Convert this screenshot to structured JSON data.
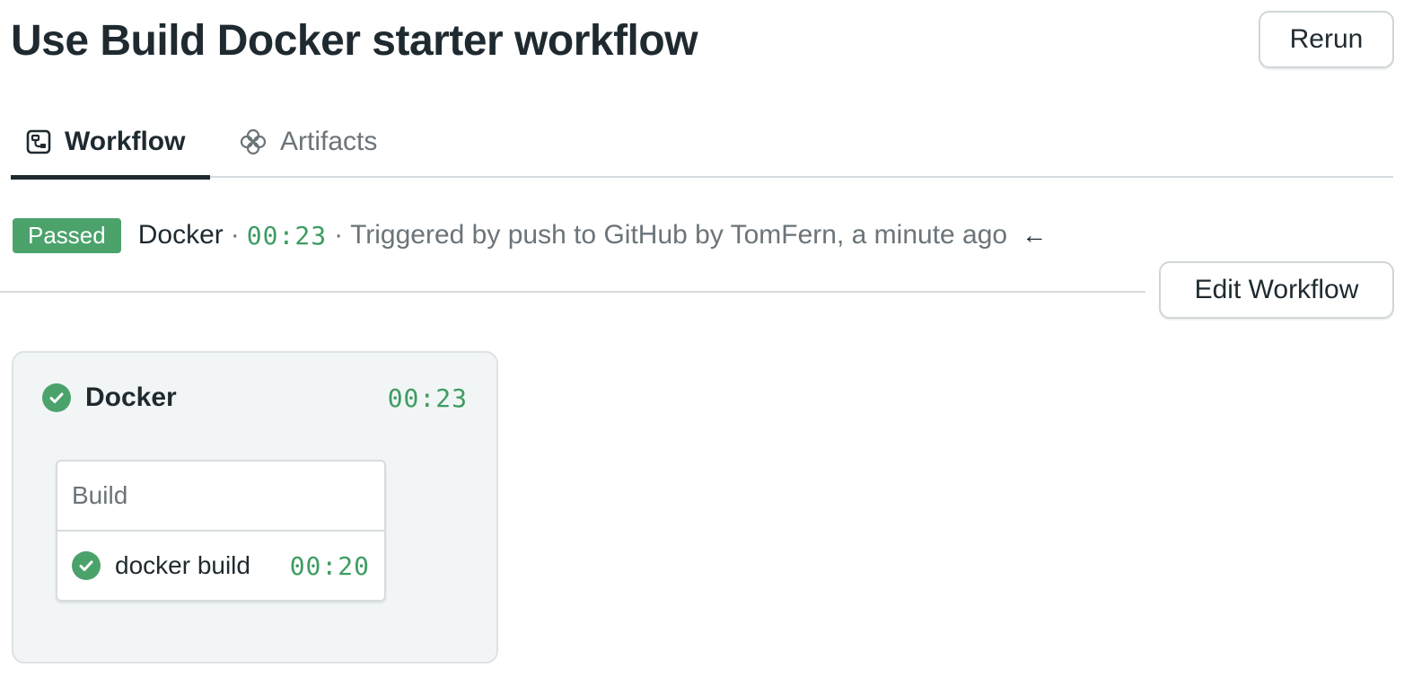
{
  "header": {
    "title": "Use Build Docker starter workflow",
    "rerun_label": "Rerun"
  },
  "tabs": [
    {
      "label": "Workflow",
      "icon": "workflow-icon",
      "active": true
    },
    {
      "label": "Artifacts",
      "icon": "artifacts-icon",
      "active": false
    }
  ],
  "status": {
    "badge": "Passed",
    "pipeline": "Docker",
    "separator": "·",
    "duration": "00:23",
    "trigger_text": "Triggered by push to GitHub by TomFern, a minute ago",
    "arrow": "←"
  },
  "toolbar": {
    "edit_label": "Edit Workflow"
  },
  "block": {
    "name": "Docker",
    "duration": "00:23",
    "status_icon": "check-circle-icon",
    "job_group": {
      "name": "Build",
      "jobs": [
        {
          "name": "docker build",
          "duration": "00:20",
          "status_icon": "check-circle-icon"
        }
      ]
    }
  },
  "colors": {
    "passed": "#4ba26b",
    "duration_text": "#3d9c62",
    "text": "#1f2a30",
    "muted": "#6b7479"
  }
}
